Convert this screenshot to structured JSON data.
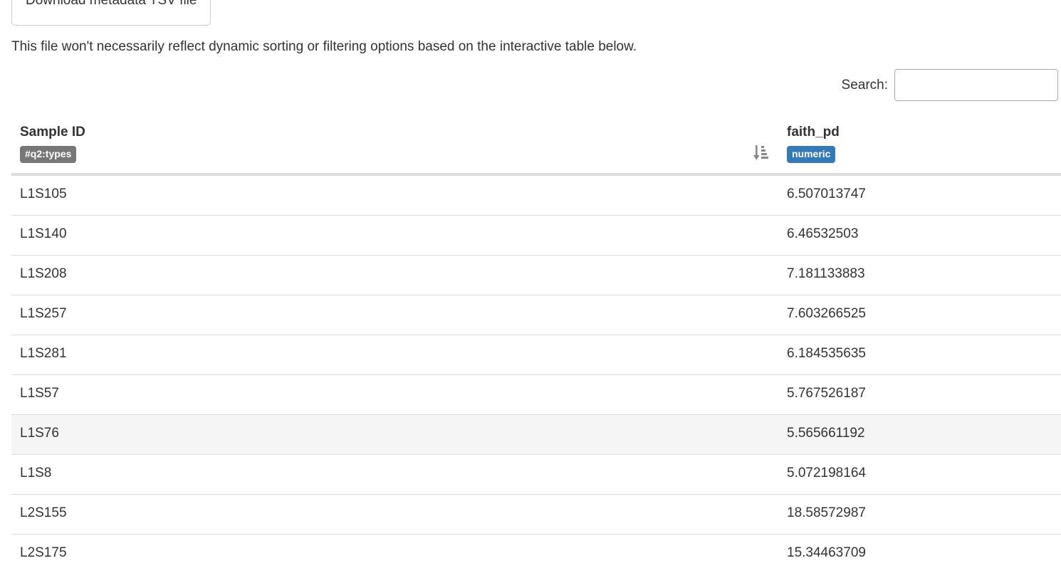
{
  "download_button": {
    "label": "Download metadata TSV file"
  },
  "note": "This file won't necessarily reflect dynamic sorting or filtering options based on the interactive table below.",
  "search": {
    "label": "Search:",
    "value": "",
    "placeholder": ""
  },
  "table": {
    "columns": [
      {
        "title": "Sample ID",
        "badge": "#q2:types",
        "badge_color": "#777777"
      },
      {
        "title": "faith_pd",
        "badge": "numeric",
        "badge_color": "#337ab7"
      }
    ],
    "sort_icon": "sort-amount-down-icon",
    "rows": [
      {
        "id": "L1S105",
        "value": "6.507013747"
      },
      {
        "id": "L1S140",
        "value": "6.46532503"
      },
      {
        "id": "L1S208",
        "value": "7.181133883"
      },
      {
        "id": "L1S257",
        "value": "7.603266525"
      },
      {
        "id": "L1S281",
        "value": "6.184535635"
      },
      {
        "id": "L1S57",
        "value": "5.767526187"
      },
      {
        "id": "L1S76",
        "value": "5.565661192"
      },
      {
        "id": "L1S8",
        "value": "5.072198164"
      },
      {
        "id": "L2S155",
        "value": "18.58572987"
      },
      {
        "id": "L2S175",
        "value": "15.34463709"
      }
    ],
    "hovered_row_index": 6
  }
}
